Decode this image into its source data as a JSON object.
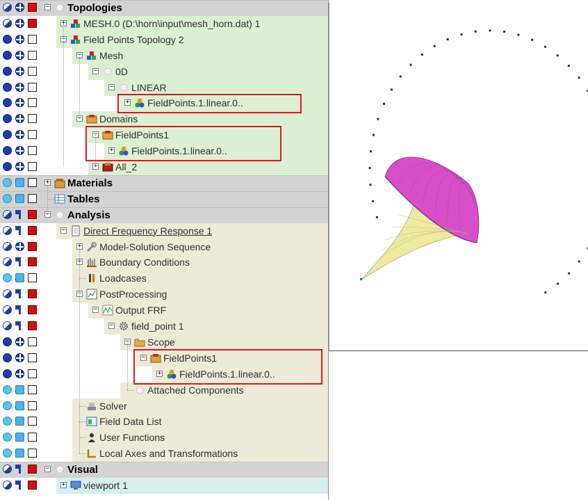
{
  "colors": {
    "section_bg": "#d3d3d3",
    "mesh_bg": "#dbefd5",
    "analysis_bg": "#ecebd8",
    "visual_bg": "#d7eeee",
    "highlight": "#e0161f",
    "dome": "#d64fc9",
    "horn": "#eceba0",
    "points": "#333333"
  },
  "tree": {
    "rows": [
      {
        "label": "Topologies",
        "indent": 0,
        "section": true,
        "bg": "section",
        "icon": "circle-icon",
        "icons": [
          "half",
          "grid",
          "red"
        ],
        "expander": "minus"
      },
      {
        "label": "MESH.0 (D:\\horn\\input\\mesh_horn.dat) 1",
        "indent": 1,
        "bg": "mesh",
        "icon": "mesh-blocks-icon",
        "icons": [
          "half",
          "grid",
          "red"
        ],
        "expander": "plus"
      },
      {
        "label": "Field Points Topology 2",
        "indent": 1,
        "bg": "mesh",
        "icon": "mesh-blocks-icon",
        "icons": [
          "full",
          "grid",
          "empty"
        ],
        "expander": "minus"
      },
      {
        "label": "Mesh",
        "indent": 2,
        "bg": "mesh",
        "icon": "mesh-blocks-icon",
        "icons": [
          "full",
          "grid",
          "empty"
        ],
        "expander": "minus"
      },
      {
        "label": "0D",
        "indent": 3,
        "bg": "mesh",
        "icon": "circle-icon",
        "icons": [
          "full",
          "grid",
          "empty"
        ],
        "expander": "minus"
      },
      {
        "label": "LINEAR",
        "indent": 4,
        "bg": "mesh",
        "icon": "circle-icon",
        "icons": [
          "full",
          "grid",
          "empty"
        ],
        "expander": "minus"
      },
      {
        "label": "FieldPoints.1.linear.0..",
        "indent": 5,
        "bg": "mesh",
        "icon": "triangle-colors-icon",
        "icons": [
          "full",
          "grid",
          "empty"
        ],
        "expander": "plus"
      },
      {
        "label": "Domains",
        "indent": 2,
        "bg": "mesh",
        "icon": "domain-box-icon",
        "icons": [
          "full",
          "grid",
          "empty"
        ],
        "expander": "minus"
      },
      {
        "label": "FieldPoints1",
        "indent": 3,
        "bg": "mesh",
        "icon": "domain-box-icon",
        "icons": [
          "full",
          "grid",
          "empty"
        ],
        "expander": "minus"
      },
      {
        "label": "FieldPoints.1.linear.0..",
        "indent": 4,
        "bg": "mesh",
        "icon": "triangle-colors-icon",
        "icons": [
          "full",
          "grid",
          "empty"
        ],
        "expander": "plus"
      },
      {
        "label": "All_2",
        "indent": 3,
        "bg": "mesh",
        "icon": "domain-red-icon",
        "icons": [
          "full",
          "grid",
          "empty"
        ],
        "expander": "plus"
      },
      {
        "label": "Materials",
        "indent": 0,
        "section": true,
        "bg": "section",
        "icon": "materials-icon",
        "icons": [
          "cyan",
          "cyansq",
          "empty"
        ],
        "expander": "plus"
      },
      {
        "label": "Tables",
        "indent": 0,
        "section": true,
        "bg": "section",
        "icon": "table-icon",
        "icons": [
          "cyan",
          "cyansq",
          "empty"
        ],
        "expander": "none"
      },
      {
        "label": "Analysis",
        "indent": 0,
        "section": true,
        "bg": "section",
        "icon": "circle-icon",
        "icons": [
          "half",
          "wand",
          "red"
        ],
        "expander": "minus"
      },
      {
        "label": "Direct Frequency Response 1",
        "indent": 1,
        "bg": "analysis",
        "icon": "document-icon",
        "icons": [
          "half",
          "wand",
          "red"
        ],
        "expander": "minus",
        "link": true
      },
      {
        "label": "Model-Solution Sequence",
        "indent": 2,
        "bg": "analysis",
        "icon": "wrench-icon",
        "icons": [
          "half",
          "grid",
          "red"
        ],
        "expander": "plus"
      },
      {
        "label": "Boundary Conditions",
        "indent": 2,
        "bg": "analysis",
        "icon": "boundary-icon",
        "icons": [
          "half",
          "wand",
          "red"
        ],
        "expander": "plus"
      },
      {
        "label": "Loadcases",
        "indent": 2,
        "bg": "analysis",
        "icon": "loadcase-icon",
        "icons": [
          "cyan",
          "cyansq",
          "empty"
        ],
        "expander": "none"
      },
      {
        "label": "PostProcessing",
        "indent": 2,
        "bg": "analysis",
        "icon": "chart-icon",
        "icons": [
          "half",
          "wand",
          "red"
        ],
        "expander": "minus"
      },
      {
        "label": "Output FRF",
        "indent": 3,
        "bg": "analysis",
        "icon": "frf-icon",
        "icons": [
          "half",
          "wand",
          "red"
        ],
        "expander": "minus"
      },
      {
        "label": "field_point 1",
        "indent": 4,
        "bg": "analysis",
        "icon": "gear-icon",
        "icons": [
          "half",
          "wand",
          "red"
        ],
        "expander": "minus"
      },
      {
        "label": "Scope",
        "indent": 5,
        "bg": "analysis",
        "icon": "folder-icon",
        "icons": [
          "full",
          "grid",
          "empty"
        ],
        "expander": "minus"
      },
      {
        "label": "FieldPoints1",
        "indent": 6,
        "bg": "analysis",
        "icon": "domain-box-icon",
        "icons": [
          "full",
          "grid",
          "empty"
        ],
        "expander": "minus"
      },
      {
        "label": "FieldPoints.1.linear.0..",
        "indent": 7,
        "bg": "analysis",
        "icon": "triangle-colors-icon",
        "icons": [
          "full",
          "grid",
          "empty"
        ],
        "expander": "plus"
      },
      {
        "label": "Attached Components",
        "indent": 5,
        "bg": "analysis",
        "icon": "circle-icon",
        "icons": [
          "cyan",
          "cyansq",
          "empty"
        ],
        "expander": "none"
      },
      {
        "label": "Solver",
        "indent": 2,
        "bg": "analysis",
        "icon": "solver-icon",
        "icons": [
          "cyan",
          "cyansq",
          "empty"
        ],
        "expander": "none"
      },
      {
        "label": "Field Data List",
        "indent": 2,
        "bg": "analysis",
        "icon": "datalist-icon",
        "icons": [
          "cyan",
          "cyansq",
          "empty"
        ],
        "expander": "none"
      },
      {
        "label": "User Functions",
        "indent": 2,
        "bg": "analysis",
        "icon": "user-icon",
        "icons": [
          "cyan",
          "cyansq",
          "empty"
        ],
        "expander": "none"
      },
      {
        "label": "Local Axes and Transformations",
        "indent": 2,
        "bg": "analysis",
        "icon": "axes-icon",
        "icons": [
          "cyan",
          "cyansq",
          "empty"
        ],
        "expander": "none"
      },
      {
        "label": "Visual",
        "indent": 0,
        "section": true,
        "bg": "section",
        "icon": "circle-icon",
        "icons": [
          "half",
          "wand",
          "red"
        ],
        "expander": "minus"
      },
      {
        "label": "viewport 1",
        "indent": 1,
        "bg": "visual",
        "icon": "monitor-icon",
        "icons": [
          "half",
          "wand",
          "red"
        ],
        "expander": "plus"
      }
    ]
  },
  "viewport": {
    "field_point_count": 39
  }
}
